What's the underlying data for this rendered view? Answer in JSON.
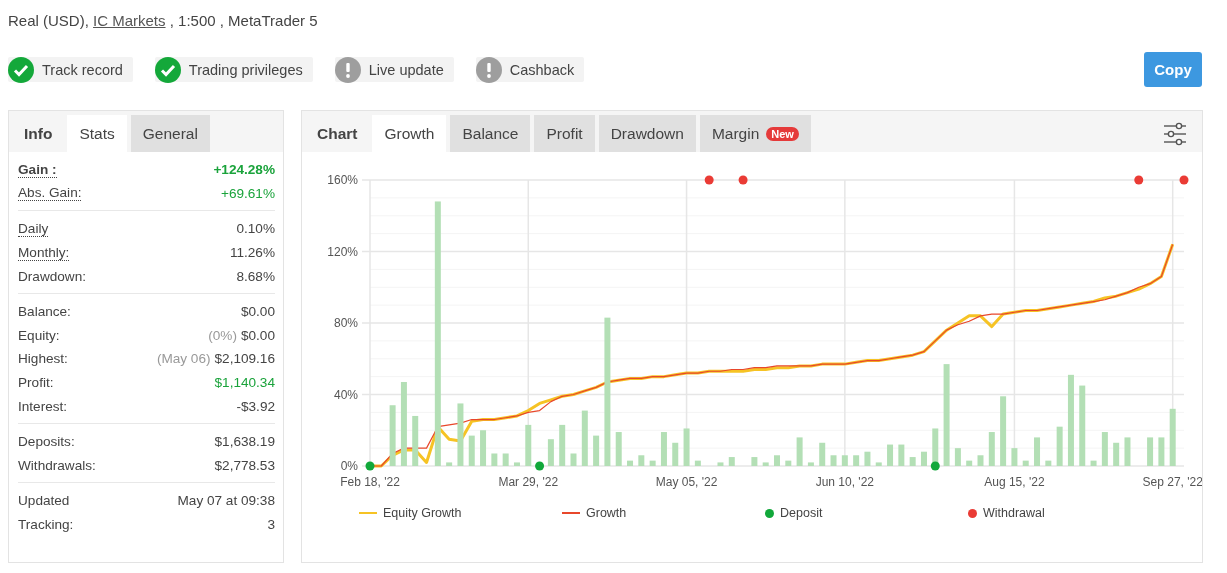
{
  "account": {
    "prefix": "Real (USD),",
    "broker": "IC Markets",
    "suffix": ", 1:500 , MetaTrader 5"
  },
  "badges": [
    {
      "label": "Track record",
      "kind": "check"
    },
    {
      "label": "Trading privileges",
      "kind": "check"
    },
    {
      "label": "Live update",
      "kind": "alert"
    },
    {
      "label": "Cashback",
      "kind": "alert"
    }
  ],
  "copy_button": "Copy",
  "stats_panel": {
    "label": "Info",
    "tabs": [
      {
        "label": "Stats",
        "selected": true
      },
      {
        "label": "General",
        "selected": false
      }
    ],
    "groups": [
      [
        {
          "label": "Gain :",
          "value": "+124.28%",
          "underlined": true,
          "emphasis": true,
          "positive": true
        },
        {
          "label": "Abs. Gain:",
          "value": "+69.61%",
          "underlined": true,
          "emphasis": false,
          "positive": true
        }
      ],
      [
        {
          "label": "Daily",
          "value": "0.10%",
          "underlined": true,
          "emphasis": false,
          "positive": false
        },
        {
          "label": "Monthly:",
          "value": "11.26%",
          "underlined": true,
          "emphasis": false,
          "positive": false
        },
        {
          "label": "Drawdown:",
          "value": "8.68%",
          "underlined": false,
          "emphasis": false,
          "positive": false
        }
      ],
      [
        {
          "label": "Balance:",
          "value": "$0.00",
          "underlined": false,
          "emphasis": false,
          "positive": false
        },
        {
          "label": "Equity:",
          "note": "(0%)",
          "value": "$0.00",
          "underlined": false,
          "emphasis": false,
          "positive": false
        },
        {
          "label": "Highest:",
          "note": "(May 06)",
          "value": "$2,109.16",
          "underlined": false,
          "emphasis": false,
          "positive": false
        },
        {
          "label": "Profit:",
          "value": "$1,140.34",
          "underlined": false,
          "emphasis": false,
          "positive": true
        },
        {
          "label": "Interest:",
          "value": "-$3.92",
          "underlined": false,
          "emphasis": false,
          "positive": false
        }
      ],
      [
        {
          "label": "Deposits:",
          "value": "$1,638.19",
          "underlined": false,
          "emphasis": false,
          "positive": false
        },
        {
          "label": "Withdrawals:",
          "value": "$2,778.53",
          "underlined": false,
          "emphasis": false,
          "positive": false
        }
      ],
      [
        {
          "label": "Updated",
          "value": "May 07 at 09:38",
          "underlined": false,
          "emphasis": false,
          "positive": false
        },
        {
          "label": "Tracking:",
          "value": "3",
          "underlined": false,
          "emphasis": false,
          "positive": false
        }
      ]
    ]
  },
  "chart_panel": {
    "label": "Chart",
    "tabs": [
      {
        "label": "Growth",
        "selected": true
      },
      {
        "label": "Balance",
        "selected": false
      },
      {
        "label": "Profit",
        "selected": false
      },
      {
        "label": "Drawdown",
        "selected": false
      },
      {
        "label": "Margin",
        "selected": false,
        "badge": "New"
      }
    ],
    "chart_data": {
      "type": "line",
      "grid": true,
      "ylim": [
        0,
        160
      ],
      "categories": [
        "Feb 18, '22",
        null,
        null,
        null,
        null,
        null,
        null,
        null,
        null,
        null,
        null,
        null,
        null,
        null,
        "Mar 29, '22",
        null,
        null,
        null,
        null,
        null,
        null,
        null,
        null,
        null,
        null,
        null,
        null,
        null,
        "May 05, '22",
        null,
        null,
        null,
        null,
        null,
        null,
        null,
        null,
        null,
        null,
        null,
        null,
        null,
        "Jun 10, '22",
        null,
        null,
        null,
        null,
        null,
        null,
        null,
        null,
        null,
        null,
        null,
        null,
        null,
        null,
        "Aug 15, '22",
        null,
        null,
        null,
        null,
        null,
        null,
        null,
        null,
        null,
        null,
        null,
        null,
        null,
        "Sep 27, '22",
        null
      ],
      "yticks": [
        {
          "value": 0,
          "label": "0%"
        },
        {
          "value": 40,
          "label": "40%"
        },
        {
          "value": 80,
          "label": "80%"
        },
        {
          "value": 120,
          "label": "120%"
        },
        {
          "value": 160,
          "label": "160%"
        }
      ],
      "series": [
        {
          "type": "bar",
          "color": "#b3dfb5",
          "values": [
            null,
            null,
            34,
            47,
            28,
            null,
            148,
            2,
            35,
            17,
            20,
            7,
            7,
            2,
            23,
            null,
            15,
            23,
            7,
            31,
            17,
            83,
            19,
            3,
            6,
            3,
            19,
            13,
            21,
            3,
            null,
            2,
            5,
            null,
            5,
            2,
            6,
            3,
            16,
            2,
            13,
            6,
            6,
            6,
            8,
            2,
            12,
            12,
            5,
            8,
            21,
            57,
            10,
            3,
            6,
            19,
            39,
            10,
            3,
            16,
            3,
            22,
            51,
            45,
            3,
            19,
            13,
            16,
            null,
            16,
            16,
            32,
            null
          ]
        },
        {
          "type": "line",
          "name": "Equity Growth",
          "color": "#f6c324",
          "values": [
            0,
            0,
            6,
            9,
            9,
            2,
            22,
            15,
            14,
            25,
            26,
            26,
            27,
            28,
            31,
            35,
            37,
            39,
            40,
            42,
            44,
            47,
            48,
            49,
            49,
            50,
            50,
            51,
            52,
            52,
            53,
            53,
            53,
            53,
            54,
            54,
            55,
            55,
            56,
            56,
            57,
            57,
            57,
            58,
            59,
            59,
            60,
            61,
            62,
            64,
            70,
            76,
            80,
            84,
            84,
            78,
            85,
            86,
            87,
            87,
            88,
            89,
            90,
            91,
            92,
            94,
            95,
            97,
            99,
            102,
            106,
            124,
            null
          ]
        },
        {
          "type": "line",
          "name": "Growth",
          "color": "#e8472b",
          "values": [
            0,
            0,
            7,
            10,
            10,
            10,
            22,
            23,
            24,
            26,
            26,
            26,
            27,
            28,
            30,
            31,
            36,
            39,
            40,
            42,
            44,
            47,
            48,
            49,
            49,
            50,
            50,
            51,
            52,
            52,
            53,
            53,
            54,
            54,
            55,
            55,
            56,
            56,
            56,
            56,
            57,
            57,
            57,
            58,
            59,
            59,
            60,
            61,
            62,
            64,
            70,
            76,
            79,
            81,
            84,
            85,
            85,
            86,
            87,
            87,
            88,
            89,
            90,
            91,
            92,
            93,
            95,
            97,
            100,
            102,
            106,
            124,
            null
          ]
        },
        {
          "type": "scatter",
          "name": "Deposit",
          "color": "#11a83a",
          "values": [
            0,
            null,
            null,
            null,
            null,
            null,
            null,
            null,
            null,
            null,
            null,
            null,
            null,
            null,
            null,
            0,
            null,
            null,
            null,
            null,
            null,
            null,
            null,
            null,
            null,
            null,
            null,
            null,
            null,
            null,
            null,
            null,
            null,
            null,
            null,
            null,
            null,
            null,
            null,
            null,
            null,
            null,
            null,
            null,
            null,
            null,
            null,
            null,
            null,
            null,
            0,
            null,
            null,
            null,
            null,
            null,
            null,
            null,
            null,
            null,
            null,
            null,
            null,
            null,
            null,
            null,
            null,
            null,
            null,
            null,
            null,
            null,
            null
          ]
        },
        {
          "type": "scatter",
          "name": "Withdrawal",
          "color": "#ea3b35",
          "values": [
            null,
            null,
            null,
            null,
            null,
            null,
            null,
            null,
            null,
            null,
            null,
            null,
            null,
            null,
            null,
            null,
            null,
            null,
            null,
            null,
            null,
            null,
            null,
            null,
            null,
            null,
            null,
            null,
            null,
            null,
            160,
            null,
            null,
            160,
            null,
            null,
            null,
            null,
            null,
            null,
            null,
            null,
            null,
            null,
            null,
            null,
            null,
            null,
            null,
            null,
            null,
            null,
            null,
            null,
            null,
            null,
            null,
            null,
            null,
            null,
            null,
            null,
            null,
            null,
            null,
            null,
            null,
            null,
            160,
            null,
            null,
            null,
            160
          ]
        }
      ]
    }
  }
}
